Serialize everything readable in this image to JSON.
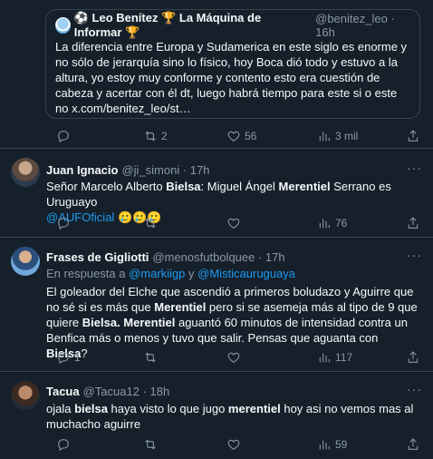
{
  "quote": {
    "name": "⚽ Leo Benítez 🏆 La Máquina de Informar 🏆",
    "handle": "@benitez_leo · 16h",
    "text": "La diferencia entre Europa y Sudamerica en este siglo es enorme y no sólo de jerarquía sino lo físico, hoy Boca dió todo y estuvo a la altura, yo estoy muy conforme y contento esto era cuestión de cabeza y acertar con él dt, luego habrá tiempo para este si o este no x.com/benitez_leo/st…"
  },
  "quote_actions": {
    "reply": "",
    "retweets": "2",
    "likes": "56",
    "views": "3 mil"
  },
  "tweets": [
    {
      "name": "Juan Ignacio",
      "handle": "@ji_simoni · 17h",
      "text_a": "Señor Marcelo Alberto ",
      "text_b": "Bielsa",
      "text_c": ": Miguel Ángel ",
      "text_d": "Merentiel",
      "text_e": " Serrano es Uruguayo ",
      "mention": "@AUFOficial",
      "emoji": " 🥲🥲🥲",
      "actions": {
        "reply": "",
        "retweets": "",
        "likes": "",
        "views": "76"
      }
    },
    {
      "name": "Frases de Gigliotti",
      "handle": "@menosfutbolquee · 17h",
      "reply_prefix": "En respuesta a ",
      "reply_user1": "@markiigp",
      "reply_and": " y ",
      "reply_user2": "@Misticauruguaya",
      "p1": "El goleador del Elche que ascendió a primeros boludazo y Aguirre que no sé si es más que ",
      "p2": "Merentiel",
      "p3": " pero si se asemeja más al tipo de 9 que quiere ",
      "p4": "Bielsa. Merentiel",
      "p5": " aguantó 60 minutos de intensidad contra un Benfica más o menos y tuvo que salir. Pensas que aguanta con ",
      "p6": "Bielsa",
      "p7": "?",
      "actions": {
        "reply": "1",
        "retweets": "",
        "likes": "",
        "views": "117"
      }
    },
    {
      "name": "Tacua",
      "handle": "@Tacua12 · 18h",
      "p1": "ojala ",
      "p2": "bielsa",
      "p3": " haya visto lo que jugo ",
      "p4": "merentiel",
      "p5": " hoy asi no vemos mas al muchacho aguirre",
      "actions": {
        "reply": "",
        "retweets": "",
        "likes": "",
        "views": "59"
      }
    }
  ],
  "more_label": "···",
  "colors": {
    "bg": "#15202b",
    "text": "#f7f9f9",
    "muted": "#8b98a5",
    "link": "#1d9bf0",
    "border": "#38444d"
  }
}
